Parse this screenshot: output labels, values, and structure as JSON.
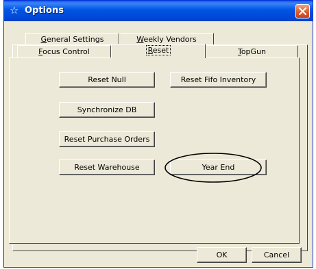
{
  "window": {
    "title": "Options"
  },
  "tabs": {
    "back_row": [
      {
        "prefix": "",
        "underline": "G",
        "rest": "eneral Settings"
      },
      {
        "prefix": "",
        "underline": "W",
        "rest": "eekly Vendors"
      }
    ],
    "front_row": [
      {
        "prefix": "",
        "underline": "F",
        "rest": "ocus Control"
      },
      {
        "prefix": "",
        "underline": "R",
        "rest": "eset"
      },
      {
        "prefix": "",
        "underline": "T",
        "rest": "opGun"
      }
    ],
    "selected": "Reset"
  },
  "reset_panel": {
    "buttons": {
      "reset_null": "Reset Null",
      "reset_fifo_inventory": "Reset Fifo Inventory",
      "synchronize_db": "Synchronize DB",
      "reset_purchase_orders": "Reset Purchase Orders",
      "reset_warehouse": "Reset Warehouse",
      "year_end": "Year End"
    }
  },
  "footer": {
    "ok_label": "OK",
    "cancel_label": "Cancel"
  },
  "colors": {
    "titlebar": "#0055e5",
    "close_button": "#e25b2b",
    "dialog_face": "#ece9d8",
    "annotation_circle": "#000000"
  },
  "icons": {
    "title": "star-outline-icon",
    "close": "close-icon"
  }
}
